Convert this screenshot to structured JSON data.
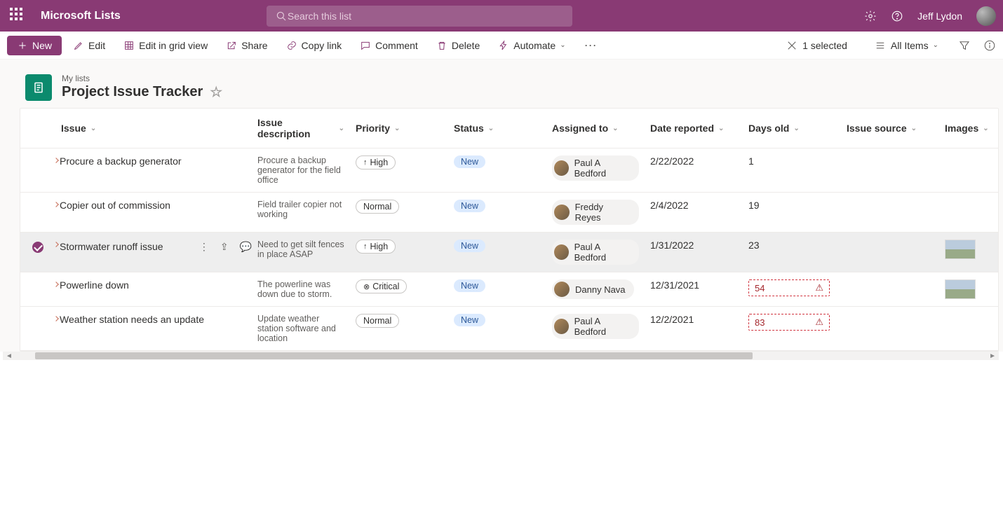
{
  "header": {
    "app_name": "Microsoft Lists",
    "search_placeholder": "Search this list",
    "user_name": "Jeff Lydon"
  },
  "commands": {
    "new": "New",
    "edit": "Edit",
    "grid": "Edit in grid view",
    "share": "Share",
    "copy": "Copy link",
    "comment": "Comment",
    "delete": "Delete",
    "automate": "Automate",
    "selected": "1 selected",
    "view": "All Items"
  },
  "list": {
    "breadcrumb": "My lists",
    "title": "Project Issue Tracker"
  },
  "columns": {
    "issue": "Issue",
    "description": "Issue description",
    "priority": "Priority",
    "status": "Status",
    "assigned": "Assigned to",
    "date": "Date reported",
    "days": "Days old",
    "source": "Issue source",
    "images": "Images"
  },
  "rows": [
    {
      "issue": "Procure a backup generator",
      "description": "Procure a backup generator for the field office",
      "priority": "High",
      "priority_type": "high",
      "status": "New",
      "assigned": "Paul A Bedford",
      "date": "2/22/2022",
      "days": "1",
      "days_warn": false,
      "has_image": false,
      "selected": false
    },
    {
      "issue": "Copier out of commission",
      "description": "Field trailer copier not working",
      "priority": "Normal",
      "priority_type": "normal",
      "status": "New",
      "assigned": "Freddy Reyes",
      "date": "2/4/2022",
      "days": "19",
      "days_warn": false,
      "has_image": false,
      "selected": false
    },
    {
      "issue": "Stormwater runoff issue",
      "description": "Need to get silt fences in place ASAP",
      "priority": "High",
      "priority_type": "high",
      "status": "New",
      "assigned": "Paul A Bedford",
      "date": "1/31/2022",
      "days": "23",
      "days_warn": false,
      "has_image": true,
      "selected": true
    },
    {
      "issue": "Powerline down",
      "description": "The powerline was down due to storm.",
      "priority": "Critical",
      "priority_type": "critical",
      "status": "New",
      "assigned": "Danny Nava",
      "date": "12/31/2021",
      "days": "54",
      "days_warn": true,
      "has_image": true,
      "selected": false
    },
    {
      "issue": "Weather station needs an update",
      "description": "Update weather station software and location",
      "priority": "Normal",
      "priority_type": "normal",
      "status": "New",
      "assigned": "Paul A Bedford",
      "date": "12/2/2021",
      "days": "83",
      "days_warn": true,
      "has_image": false,
      "selected": false
    }
  ]
}
